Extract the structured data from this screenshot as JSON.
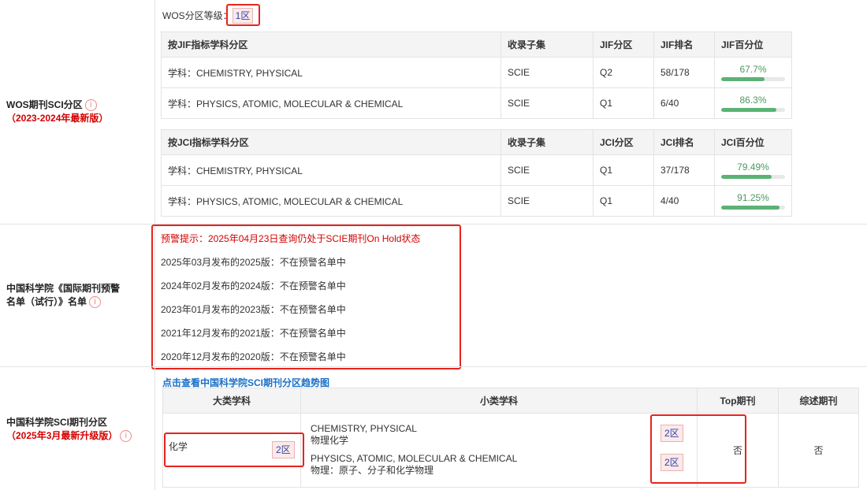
{
  "wos": {
    "label": "WOS期刊SCI分区",
    "label_sub": "（2023-2024年最新版）",
    "level_label": "WOS分区等级：",
    "level_value": "1区",
    "jif_table": {
      "headers": [
        "按JIF指标学科分区",
        "收录子集",
        "JIF分区",
        "JIF排名",
        "JIF百分位"
      ],
      "rows": [
        {
          "subject": "学科：CHEMISTRY, PHYSICAL",
          "subset": "SCIE",
          "quartile": "Q2",
          "rank": "58/178",
          "pct_text": "67.7%",
          "pct": 67.7
        },
        {
          "subject": "学科：PHYSICS, ATOMIC, MOLECULAR & CHEMICAL",
          "subset": "SCIE",
          "quartile": "Q1",
          "rank": "6/40",
          "pct_text": "86.3%",
          "pct": 86.3
        }
      ]
    },
    "jci_table": {
      "headers": [
        "按JCI指标学科分区",
        "收录子集",
        "JCI分区",
        "JCI排名",
        "JCI百分位"
      ],
      "rows": [
        {
          "subject": "学科：CHEMISTRY, PHYSICAL",
          "subset": "SCIE",
          "quartile": "Q1",
          "rank": "37/178",
          "pct_text": "79.49%",
          "pct": 79.49
        },
        {
          "subject": "学科：PHYSICS, ATOMIC, MOLECULAR & CHEMICAL",
          "subset": "SCIE",
          "quartile": "Q1",
          "rank": "4/40",
          "pct_text": "91.25%",
          "pct": 91.25
        }
      ]
    }
  },
  "warning": {
    "label_line1": "中国科学院《国际期刊预警",
    "label_line2": "名单（试行）》名单",
    "lines": [
      "预警提示：2025年04月23日查询仍处于SCIE期刊On Hold状态",
      "2025年03月发布的2025版：不在预警名单中",
      "2024年02月发布的2024版：不在预警名单中",
      "2023年01月发布的2023版：不在预警名单中",
      "2021年12月发布的2021版：不在预警名单中",
      "2020年12月发布的2020版：不在预警名单中"
    ]
  },
  "cas": {
    "label": "中国科学院SCI期刊分区",
    "label_sub": "（2025年3月最新升级版）",
    "trend_link": "点击查看中国科学院SCI期刊分区趋势图",
    "headers": [
      "大类学科",
      "小类学科",
      "Top期刊",
      "综述期刊"
    ],
    "major_subject": "化学",
    "major_zone": "2区",
    "minor": [
      {
        "en": "CHEMISTRY, PHYSICAL",
        "cn": "物理化学",
        "zone": "2区"
      },
      {
        "en": "PHYSICS, ATOMIC, MOLECULAR & CHEMICAL",
        "cn": "物理：原子、分子和化学物理",
        "zone": "2区"
      }
    ],
    "top": "否",
    "review": "否"
  },
  "icons": {
    "info": "info-circle-icon"
  }
}
